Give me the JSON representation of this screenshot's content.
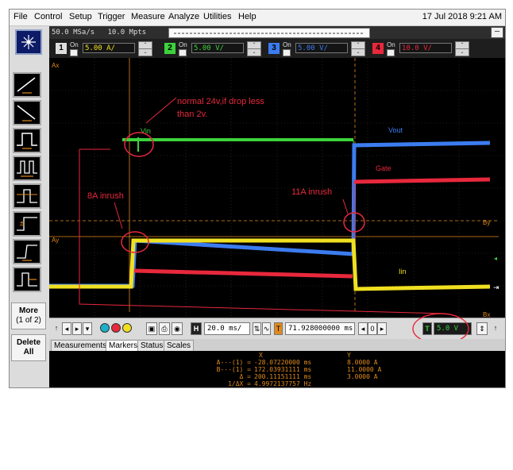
{
  "menubar": {
    "items": [
      "File",
      "Control",
      "Setup",
      "Trigger",
      "Measure",
      "Analyze",
      "Utilities",
      "Help"
    ],
    "datetime": "17 Jul 2018  9:21 AM"
  },
  "acquisition": {
    "sample_rate": "50.0 MSa/s",
    "memory_depth": "10.0 Mpts"
  },
  "minimize_label": "–",
  "channels": [
    {
      "num": "1",
      "on": "On",
      "scale": "5.00 A/",
      "color": "#f0e020"
    },
    {
      "num": "2",
      "on": "On",
      "scale": "5.00 V/",
      "color": "#3cd23c"
    },
    {
      "num": "3",
      "on": "On",
      "scale": "5.00 V/",
      "color": "#3c7cf0"
    },
    {
      "num": "4",
      "on": "On",
      "scale": "10.0 V/",
      "color": "#e8283c"
    }
  ],
  "screen": {
    "marker_labels": {
      "ax": "Ax",
      "ay": "Ay",
      "by": "By",
      "bx": "Bx"
    },
    "traces": {
      "vin": "Vin",
      "vout": "Vout",
      "gate": "Gate",
      "iin": "Iin"
    },
    "annotations": {
      "normal_line1": "normal 24v,if drop less",
      "normal_line2": "than 2v.",
      "inrush_8a": "8A inrush",
      "inrush_11a": "11A inrush"
    }
  },
  "controls": {
    "time_scale": "20.0 ms/",
    "delay": "71.928000000 ms",
    "trigger_level": "5.0 V",
    "h_label": "H",
    "t_label": "T"
  },
  "sidebar": {
    "more_label": "More",
    "more_page": "(1 of 2)",
    "delete_line1": "Delete",
    "delete_line2": "All"
  },
  "tabs": [
    "Measurements",
    "Markers",
    "Status",
    "Scales"
  ],
  "markers_panel": {
    "col_x": "X",
    "col_y": "Y",
    "rows": [
      {
        "label": "A---(1) =",
        "x": "-28.07220000 ms",
        "y": "8.0000 A"
      },
      {
        "label": "B---(1) =",
        "x": "172.03931111 ms",
        "y": "11.0000 A"
      },
      {
        "label": "Δ =",
        "x": "200.11151111 ms",
        "y": "3.0000 A"
      },
      {
        "label": "1/ΔX =",
        "x": "4.9972137757 Hz",
        "y": ""
      }
    ]
  }
}
